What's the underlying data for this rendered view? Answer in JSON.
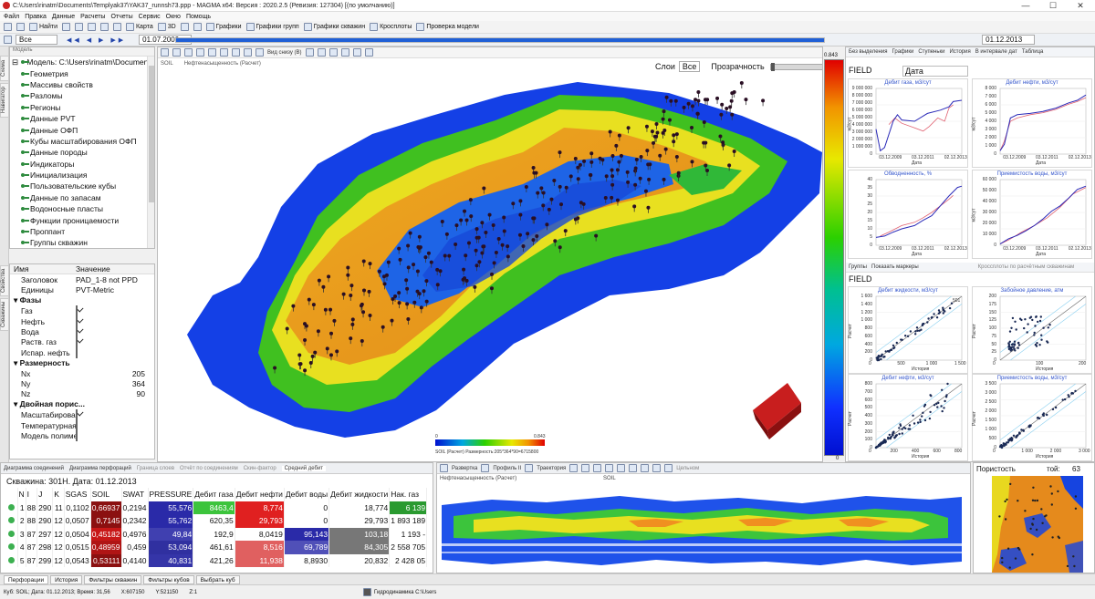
{
  "window": {
    "title": "C:\\Users\\rinatm\\Documents\\Templyak37\\YAK37_runnsh73.ppp - MAGMA x64: Версия : 2020.2.5 (Ревизия: 127304) [(по умолчанию)]",
    "minimize": "—",
    "maximize": "☐",
    "close": "✕"
  },
  "menu": [
    "Файл",
    "Правка",
    "Данные",
    "Расчеты",
    "Отчеты",
    "Сервис",
    "Окно",
    "Помощь"
  ],
  "toolbar": {
    "find": "Найти",
    "map": "Карта",
    "view3d": "3D",
    "graphs": "Графики",
    "group_graphs": "Графики групп",
    "well_graphs": "Графики скважин",
    "crossplots": "Кросплоты",
    "model_check": "Проверка модели"
  },
  "timebar": {
    "selector": "Все",
    "start_date": "01.07.2009",
    "end_date": "01.12.2013"
  },
  "left_tabs": [
    "Схема",
    "Навигатор",
    "Свойства",
    "Скважины"
  ],
  "model_tree": {
    "header": "Модель",
    "root": "Модель: C:\\Users\\rinatm\\Documents",
    "items": [
      "Геометрия",
      "Массивы свойств",
      "Разломы",
      "Регионы",
      "Данные PVT",
      "Данные ОФП",
      "Кубы масштабирования ОФП",
      "Данные породы",
      "Индикаторы",
      "Инициализация",
      "Пользовательские кубы",
      "Данные по запасам",
      "Водоносные пласты",
      "Функции проницаемости",
      "Проппант",
      "Группы скважин"
    ]
  },
  "properties": {
    "col_name": "Имя",
    "col_value": "Значение",
    "rows": [
      {
        "k": "Заголовок",
        "v": "PAD_1-8 not PPD"
      },
      {
        "k": "Единицы",
        "v": "PVT-Metric"
      }
    ],
    "phases_group": "Фазы",
    "phases": [
      {
        "k": "Газ",
        "checked": true
      },
      {
        "k": "Нефть",
        "checked": true
      },
      {
        "k": "Вода",
        "checked": true
      },
      {
        "k": "Раств. газ",
        "checked": true
      },
      {
        "k": "Испар. нефть",
        "checked": false
      }
    ],
    "dims_group": "Размерность",
    "dims": [
      {
        "k": "Nx",
        "v": "205"
      },
      {
        "k": "Ny",
        "v": "364"
      },
      {
        "k": "Nz",
        "v": "90"
      }
    ],
    "dual_group": "Двойная порис...",
    "dual": [
      {
        "k": "Масштабирован...",
        "checked": true
      },
      {
        "k": "Температурная ...",
        "checked": false
      },
      {
        "k": "Модель полиме...",
        "checked": false
      }
    ]
  },
  "viewport": {
    "toolbar_label": "Вид снизу (В)",
    "property": "Нефтенасыщенность (Расчет)",
    "left_label": "SOIL",
    "layers_label": "Слои",
    "layers_value": "Все",
    "transparency_label": "Прозрачность",
    "legend_min": "0",
    "legend_max": "0.843",
    "legend_caption": "SOIL (Расчет) Размерность:205*364*90=6715800"
  },
  "colorbar": {
    "top": "0.843",
    "bottom": "0"
  },
  "right_panel": {
    "toolbar_items": [
      "Без выделения",
      "Графики",
      "Ступеньки",
      "История",
      "В интервале дат",
      "Таблица"
    ],
    "field_label": "FIELD",
    "date_label": "Дата",
    "field_label2": "FIELD",
    "crossplot_toolbar": [
      "Группы",
      "Показать маркеры",
      "Кроссплоты по расчётным скважинам"
    ],
    "ts_charts": [
      {
        "title": "Дебит газа, м3/сут",
        "ylabel": "м3/сут",
        "xlabel": "Дата",
        "yticks": [
          "9 000 000",
          "8 000 000",
          "7 000 000",
          "6 000 000",
          "5 000 000",
          "4 000 000",
          "3 000 000",
          "2 000 000",
          "1 000 000",
          "0"
        ],
        "xticks": [
          "03.12.2009",
          "03.12.2011",
          "02.12.2013"
        ]
      },
      {
        "title": "Дебит нефти, м3/сут",
        "ylabel": "м3/сут",
        "xlabel": "Дата",
        "yticks": [
          "8 000",
          "7 000",
          "6 000",
          "5 000",
          "4 000",
          "3 000",
          "2 000",
          "1 000",
          "0"
        ],
        "xticks": [
          "03.12.2009",
          "03.12.2011",
          "02.12.2013"
        ]
      },
      {
        "title": "Обводненность, %",
        "ylabel": "%",
        "xlabel": "Дата",
        "yticks": [
          "40",
          "35",
          "30",
          "25",
          "20",
          "15",
          "10",
          "5",
          "0"
        ],
        "xticks": [
          "03.12.2009",
          "03.12.2011",
          "02.12.2013"
        ]
      },
      {
        "title": "Приемистость воды, м3/сут",
        "ylabel": "м3/сут",
        "xlabel": "Дата",
        "yticks": [
          "60 000",
          "50 000",
          "40 000",
          "30 000",
          "20 000",
          "10 000",
          "0"
        ],
        "xticks": [
          "03.12.2009",
          "03.12.2011",
          "02.12.2013"
        ]
      }
    ],
    "cross_charts": [
      {
        "title": "Дебит жидкости, м3/сут",
        "ylabel": "Расчет",
        "xlabel": "История",
        "yticks": [
          "1 600",
          "1 400",
          "1 200",
          "1 000",
          "800",
          "600",
          "400",
          "200",
          "0"
        ],
        "xticks": [
          "0",
          "500",
          "1 000",
          "1 500"
        ],
        "marker": "501"
      },
      {
        "title": "Забойное давление, атм",
        "ylabel": "Расчет",
        "xlabel": "История",
        "yticks": [
          "200",
          "175",
          "150",
          "125",
          "100",
          "75",
          "50",
          "25",
          "0"
        ],
        "xticks": [
          "0",
          "100",
          "200"
        ],
        "marker": ""
      },
      {
        "title": "Дебит нефти, м3/сут",
        "ylabel": "Расчет",
        "xlabel": "История",
        "yticks": [
          "800",
          "700",
          "600",
          "500",
          "400",
          "300",
          "200",
          "100",
          "0"
        ],
        "xticks": [
          "0",
          "200",
          "400",
          "600",
          "800"
        ],
        "marker": ""
      },
      {
        "title": "Приемистость воды, м3/сут",
        "ylabel": "Расчет",
        "xlabel": "История",
        "yticks": [
          "3 500",
          "3 000",
          "2 500",
          "2 000",
          "1 500",
          "1 000",
          "500",
          "0"
        ],
        "xticks": [
          "0",
          "1 000",
          "2 000",
          "3 000"
        ],
        "marker": ""
      }
    ]
  },
  "bottom_panel": {
    "tabs": [
      "Диаграмма соединений",
      "Диаграмма перфораций",
      "Граница слоев",
      "Отчёт по соединениям",
      "Скин-фактор",
      "Средний дебит"
    ],
    "well_header": "Скважина: 301Н. Дата: 01.12.2013",
    "columns": [
      "N",
      "I",
      "J",
      "K",
      "SGAS",
      "SOIL",
      "SWAT",
      "PRESSURE",
      "Дебит газа",
      "Дебит нефти",
      "Дебит воды",
      "Дебит жидкости",
      "Нак. газ"
    ],
    "rows": [
      [
        "1",
        "88",
        "290",
        "11",
        "0,1102",
        "0,66937",
        "0,2194",
        "55,576",
        "8463,4",
        "8,774",
        "0",
        "18,774",
        "6 139"
      ],
      [
        "2",
        "88",
        "290",
        "12",
        "0,0507",
        "0,7145",
        "0,2342",
        "55,762",
        "620,35",
        "29,793",
        "0",
        "29,793",
        "1 893 189"
      ],
      [
        "3",
        "87",
        "297",
        "12",
        "0,0504",
        "0,45182",
        "0,4976",
        "49,84",
        "192,9",
        "8,0419",
        "95,143",
        "103,18",
        "1 193 -"
      ],
      [
        "4",
        "87",
        "298",
        "12",
        "0,0515",
        "0,48959",
        "0,459",
        "53,094",
        "461,61",
        "8,516",
        "69,789",
        "84,305",
        "2 558 705"
      ],
      [
        "5",
        "87",
        "299",
        "12",
        "0,0543",
        "0,53111",
        "0,4140",
        "40,831",
        "421,26",
        "11,938",
        "8,8930",
        "20,832",
        "2 428 05"
      ]
    ]
  },
  "profile_panel": {
    "tools": [
      "Развертка",
      "Профиль II",
      "Траектория"
    ],
    "label_left": "Нефтенасыщенность (Расчет)",
    "label_center": "SOIL",
    "extra": "Цельном"
  },
  "porosity_panel": {
    "title": "Пористость",
    "label_right": "той:",
    "number": "63"
  },
  "bottom_tabs": [
    "Перфорации",
    "История",
    "Фильтры скважин",
    "Фильтры кубов",
    "Выбрать куб"
  ],
  "status": {
    "cube": "Куб: SOIL; Дата: 01.12.2013; Время: 31,56",
    "x": "X:607150",
    "y": "Y:521150",
    "z": "Z:1",
    "hydro": "Гидродинамика C:\\Users"
  },
  "colors": {
    "accent": "#1f5fd6",
    "chart_blue": "#2a2ab8",
    "chart_red": "#e06070",
    "arrow": "#c81e1e"
  }
}
